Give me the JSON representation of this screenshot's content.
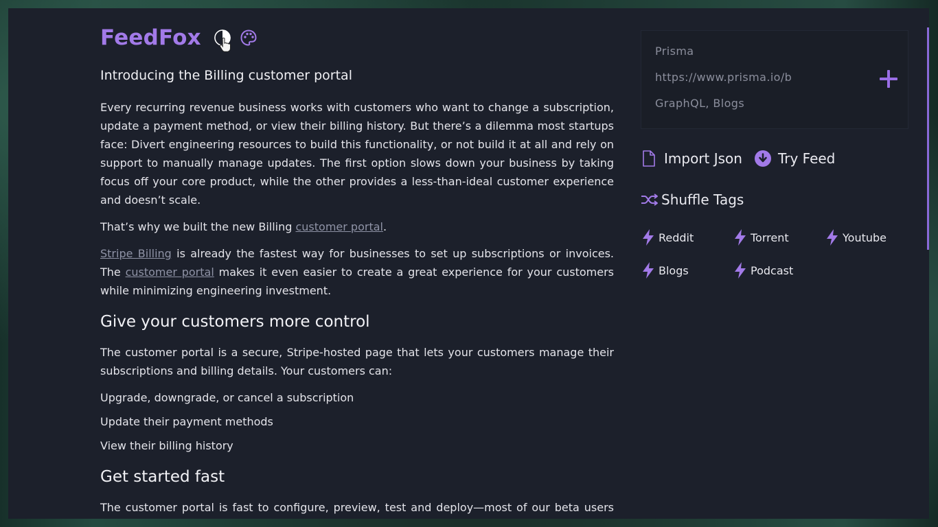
{
  "app": {
    "brand": "FeedFox"
  },
  "header_icons": [
    "theme-toggle-icon",
    "palette-icon"
  ],
  "article": {
    "heading": "Introducing the Billing customer portal",
    "p1": "Every recurring revenue business works with customers who want to change a subscription, update a payment method, or view their billing history. But there’s a dilemma most startups face: Divert engineering resources to build this functionality, or not build it at all and rely on support to manually manage updates. The first option slows down your business by taking focus off your core product, while the other provides a less-than-ideal customer experience and doesn’t scale.",
    "p2_before": "That’s why we built the new Billing ",
    "p2_link": "customer portal",
    "p2_after": ".",
    "p3_link1": "Stripe Billing",
    "p3_mid": " is already the fastest way for businesses to set up subscriptions or invoices. The ",
    "p3_link2": "customer portal",
    "p3_after": " makes it even easier to create a great experience for your customers while minimizing engineering investment.",
    "h2_1": "Give your customers more control",
    "p4": "The customer portal is a secure, Stripe-hosted page that lets your customers manage their subscriptions and billing details. Your customers can:",
    "list": [
      "Upgrade, downgrade, or cancel a subscription",
      "Update their payment methods",
      "View their billing history"
    ],
    "h2_2": "Get started fast",
    "p5": "The customer portal is fast to configure, preview, test and deploy—most of our beta users went"
  },
  "form": {
    "name_value": "Prisma",
    "url_value": "https://www.prisma.io/b",
    "tags_value": "GraphQL, Blogs"
  },
  "actions": {
    "import_label": "Import Json",
    "try_label": "Try Feed"
  },
  "shuffle_label": "Shuffle Tags",
  "tags": [
    "Reddit",
    "Torrent",
    "Youtube",
    "Blogs",
    "Podcast"
  ],
  "colors": {
    "accent": "#a27ae8",
    "panel_bg": "#1c202b",
    "text": "#e4e4ea",
    "muted": "#8b8e9c"
  }
}
